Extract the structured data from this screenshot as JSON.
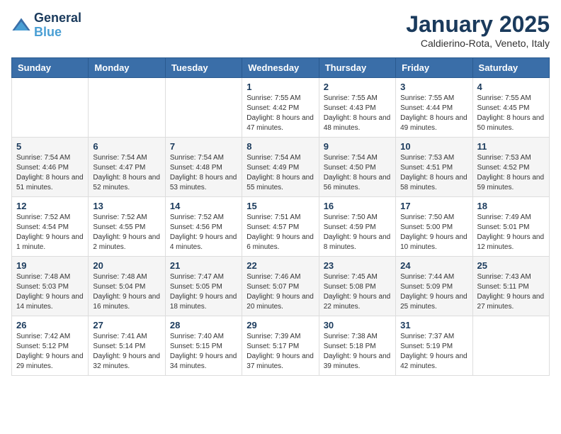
{
  "logo": {
    "line1": "General",
    "line2": "Blue"
  },
  "title": "January 2025",
  "location": "Caldierino-Rota, Veneto, Italy",
  "weekdays": [
    "Sunday",
    "Monday",
    "Tuesday",
    "Wednesday",
    "Thursday",
    "Friday",
    "Saturday"
  ],
  "weeks": [
    [
      {
        "day": "",
        "detail": ""
      },
      {
        "day": "",
        "detail": ""
      },
      {
        "day": "",
        "detail": ""
      },
      {
        "day": "1",
        "detail": "Sunrise: 7:55 AM\nSunset: 4:42 PM\nDaylight: 8 hours\nand 47 minutes."
      },
      {
        "day": "2",
        "detail": "Sunrise: 7:55 AM\nSunset: 4:43 PM\nDaylight: 8 hours\nand 48 minutes."
      },
      {
        "day": "3",
        "detail": "Sunrise: 7:55 AM\nSunset: 4:44 PM\nDaylight: 8 hours\nand 49 minutes."
      },
      {
        "day": "4",
        "detail": "Sunrise: 7:55 AM\nSunset: 4:45 PM\nDaylight: 8 hours\nand 50 minutes."
      }
    ],
    [
      {
        "day": "5",
        "detail": "Sunrise: 7:54 AM\nSunset: 4:46 PM\nDaylight: 8 hours\nand 51 minutes."
      },
      {
        "day": "6",
        "detail": "Sunrise: 7:54 AM\nSunset: 4:47 PM\nDaylight: 8 hours\nand 52 minutes."
      },
      {
        "day": "7",
        "detail": "Sunrise: 7:54 AM\nSunset: 4:48 PM\nDaylight: 8 hours\nand 53 minutes."
      },
      {
        "day": "8",
        "detail": "Sunrise: 7:54 AM\nSunset: 4:49 PM\nDaylight: 8 hours\nand 55 minutes."
      },
      {
        "day": "9",
        "detail": "Sunrise: 7:54 AM\nSunset: 4:50 PM\nDaylight: 8 hours\nand 56 minutes."
      },
      {
        "day": "10",
        "detail": "Sunrise: 7:53 AM\nSunset: 4:51 PM\nDaylight: 8 hours\nand 58 minutes."
      },
      {
        "day": "11",
        "detail": "Sunrise: 7:53 AM\nSunset: 4:52 PM\nDaylight: 8 hours\nand 59 minutes."
      }
    ],
    [
      {
        "day": "12",
        "detail": "Sunrise: 7:52 AM\nSunset: 4:54 PM\nDaylight: 9 hours\nand 1 minute."
      },
      {
        "day": "13",
        "detail": "Sunrise: 7:52 AM\nSunset: 4:55 PM\nDaylight: 9 hours\nand 2 minutes."
      },
      {
        "day": "14",
        "detail": "Sunrise: 7:52 AM\nSunset: 4:56 PM\nDaylight: 9 hours\nand 4 minutes."
      },
      {
        "day": "15",
        "detail": "Sunrise: 7:51 AM\nSunset: 4:57 PM\nDaylight: 9 hours\nand 6 minutes."
      },
      {
        "day": "16",
        "detail": "Sunrise: 7:50 AM\nSunset: 4:59 PM\nDaylight: 9 hours\nand 8 minutes."
      },
      {
        "day": "17",
        "detail": "Sunrise: 7:50 AM\nSunset: 5:00 PM\nDaylight: 9 hours\nand 10 minutes."
      },
      {
        "day": "18",
        "detail": "Sunrise: 7:49 AM\nSunset: 5:01 PM\nDaylight: 9 hours\nand 12 minutes."
      }
    ],
    [
      {
        "day": "19",
        "detail": "Sunrise: 7:48 AM\nSunset: 5:03 PM\nDaylight: 9 hours\nand 14 minutes."
      },
      {
        "day": "20",
        "detail": "Sunrise: 7:48 AM\nSunset: 5:04 PM\nDaylight: 9 hours\nand 16 minutes."
      },
      {
        "day": "21",
        "detail": "Sunrise: 7:47 AM\nSunset: 5:05 PM\nDaylight: 9 hours\nand 18 minutes."
      },
      {
        "day": "22",
        "detail": "Sunrise: 7:46 AM\nSunset: 5:07 PM\nDaylight: 9 hours\nand 20 minutes."
      },
      {
        "day": "23",
        "detail": "Sunrise: 7:45 AM\nSunset: 5:08 PM\nDaylight: 9 hours\nand 22 minutes."
      },
      {
        "day": "24",
        "detail": "Sunrise: 7:44 AM\nSunset: 5:09 PM\nDaylight: 9 hours\nand 25 minutes."
      },
      {
        "day": "25",
        "detail": "Sunrise: 7:43 AM\nSunset: 5:11 PM\nDaylight: 9 hours\nand 27 minutes."
      }
    ],
    [
      {
        "day": "26",
        "detail": "Sunrise: 7:42 AM\nSunset: 5:12 PM\nDaylight: 9 hours\nand 29 minutes."
      },
      {
        "day": "27",
        "detail": "Sunrise: 7:41 AM\nSunset: 5:14 PM\nDaylight: 9 hours\nand 32 minutes."
      },
      {
        "day": "28",
        "detail": "Sunrise: 7:40 AM\nSunset: 5:15 PM\nDaylight: 9 hours\nand 34 minutes."
      },
      {
        "day": "29",
        "detail": "Sunrise: 7:39 AM\nSunset: 5:17 PM\nDaylight: 9 hours\nand 37 minutes."
      },
      {
        "day": "30",
        "detail": "Sunrise: 7:38 AM\nSunset: 5:18 PM\nDaylight: 9 hours\nand 39 minutes."
      },
      {
        "day": "31",
        "detail": "Sunrise: 7:37 AM\nSunset: 5:19 PM\nDaylight: 9 hours\nand 42 minutes."
      },
      {
        "day": "",
        "detail": ""
      }
    ]
  ]
}
